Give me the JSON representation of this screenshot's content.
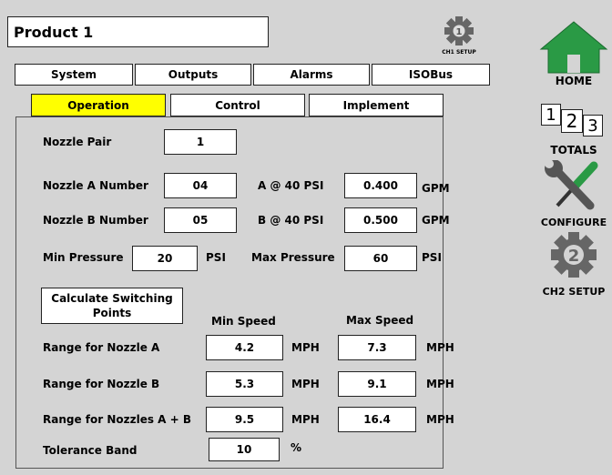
{
  "header": {
    "title": "Product 1",
    "ch1_setup_label": "CH1 SETUP",
    "ch1_number": "1"
  },
  "tabs": [
    "System",
    "Outputs",
    "Alarms",
    "ISOBus"
  ],
  "subtabs": [
    "Operation",
    "Control",
    "Implement"
  ],
  "active_subtab": "Operation",
  "form": {
    "nozzle_pair_label": "Nozzle Pair",
    "nozzle_pair_value": "1",
    "nozzle_a_label": "Nozzle A Number",
    "nozzle_a_value": "04",
    "a_at_psi_label": "A @ 40 PSI",
    "a_at_psi_value": "0.400",
    "gpm_a": "GPM",
    "nozzle_b_label": "Nozzle B Number",
    "nozzle_b_value": "05",
    "b_at_psi_label": "B @ 40 PSI",
    "b_at_psi_value": "0.500",
    "gpm_b": "GPM",
    "min_pressure_label": "Min Pressure",
    "min_pressure_value": "20",
    "min_psi_unit": "PSI",
    "max_pressure_label": "Max Pressure",
    "max_pressure_value": "60",
    "max_psi_unit": "PSI",
    "calculate_button_line1": "Calculate Switching",
    "calculate_button_line2": "Points",
    "min_speed_header": "Min Speed",
    "max_speed_header": "Max Speed",
    "ranges": [
      {
        "label": "Range for Nozzle A",
        "min": "4.2",
        "max": "7.3",
        "unit": "MPH"
      },
      {
        "label": "Range for Nozzle B",
        "min": "5.3",
        "max": "9.1",
        "unit": "MPH"
      },
      {
        "label": "Range for Nozzles A + B",
        "min": "9.5",
        "max": "16.4",
        "unit": "MPH"
      }
    ],
    "tolerance_label": "Tolerance Band",
    "tolerance_value": "10",
    "tolerance_unit": "%"
  },
  "nav": {
    "home_label": "HOME",
    "totals_label": "TOTALS",
    "totals_digits": [
      "1",
      "2",
      "3"
    ],
    "configure_label": "CONFIGURE",
    "ch2_setup_label": "CH2 SETUP",
    "ch2_number": "2"
  },
  "colors": {
    "active_tab": "#ffff00",
    "home_green": "#2a9a45",
    "background": "#d4d4d4"
  }
}
